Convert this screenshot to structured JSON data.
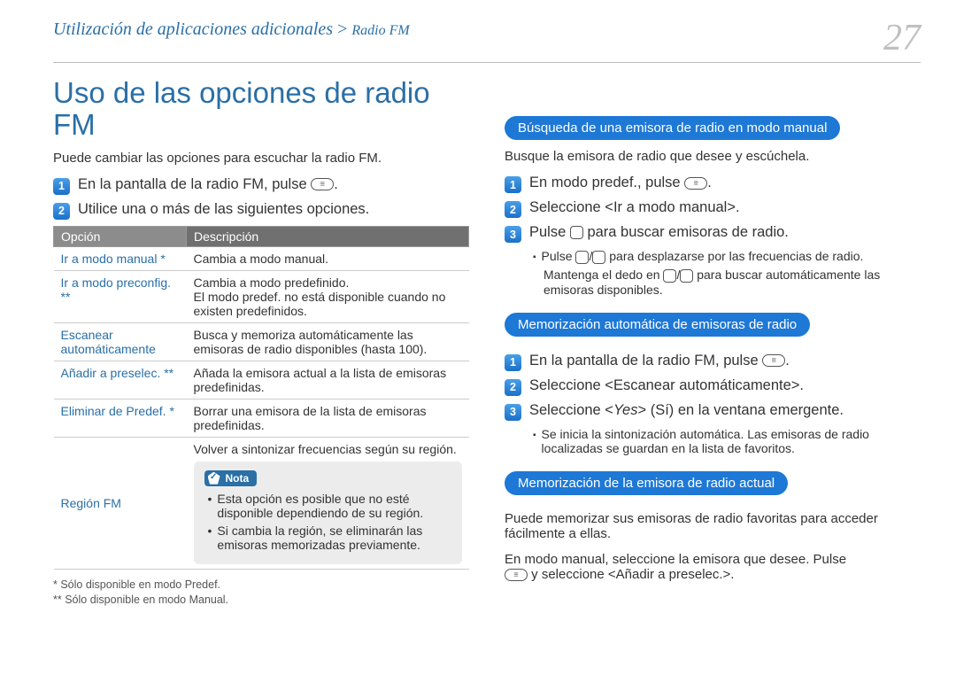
{
  "header": {
    "breadcrumb_main": "Utilización de aplicaciones adicionales",
    "breadcrumb_sub": "Radio FM",
    "page_number": "27"
  },
  "left": {
    "title": "Uso de las opciones de radio FM",
    "intro": "Puede cambiar las opciones para escuchar la radio FM.",
    "steps": [
      "En la pantalla de la radio FM, pulse",
      "Utilice una o más de las siguientes opciones."
    ],
    "table": {
      "head_option": "Opción",
      "head_desc": "Descripción",
      "rows": [
        {
          "opt": "Ir a modo manual *",
          "desc": "Cambia a modo manual."
        },
        {
          "opt": "Ir a modo preconfig. **",
          "desc": "Cambia a modo predefinido.\nEl modo predef. no está disponible cuando no existen predefinidos."
        },
        {
          "opt": "Escanear automáticamente",
          "desc": "Busca y memoriza automáticamente las emisoras de radio disponibles (hasta 100)."
        },
        {
          "opt": "Añadir a preselec. **",
          "desc": "Añada la emisora actual a la lista de emisoras predefinidas."
        },
        {
          "opt": "Eliminar de Predef. *",
          "desc": "Borrar una emisora de la lista de emisoras predefinidas."
        },
        {
          "opt": "Región FM",
          "desc": "Volver a sintonizar frecuencias según su región."
        }
      ],
      "note_label": "Nota",
      "note_items": [
        "Esta opción es posible que no esté disponible dependiendo de su región.",
        "Si cambia la región, se eliminarán las emisoras memorizadas previamente."
      ]
    },
    "foot1": "* Sólo disponible en modo Predef.",
    "foot2": "** Sólo disponible en modo Manual."
  },
  "right": {
    "sec1": {
      "pill": "Búsqueda de una emisora de radio en modo manual",
      "intro": "Busque la emisora de radio que desee y escúchela.",
      "steps": [
        "En modo predef., pulse",
        "Seleccione <Ir a modo manual>.",
        "Pulse     para buscar emisoras de radio."
      ],
      "sub1a": "Pulse ",
      "sub1b": " para desplazarse por las frecuencias de radio.",
      "sub2a": "Mantenga el dedo en ",
      "sub2b": " para buscar automáticamente las emisoras disponibles."
    },
    "sec2": {
      "pill": "Memorización automática de emisoras de radio",
      "steps": [
        "En la pantalla de la radio FM, pulse",
        "Seleccione <Escanear automáticamente>.",
        "Seleccione <Yes> (Sí) en la ventana emergente."
      ],
      "sub": "Se inicia la sintonización automática. Las emisoras de radio localizadas se guardan en la lista de favoritos."
    },
    "sec3": {
      "pill": "Memorización de la emisora de radio actual",
      "p1": "Puede memorizar sus emisoras de radio favoritas para acceder fácilmente a ellas.",
      "p2a": "En modo manual, seleccione la emisora que desee. Pulse ",
      "p2b": " y seleccione <Añadir a preselec.>."
    }
  }
}
